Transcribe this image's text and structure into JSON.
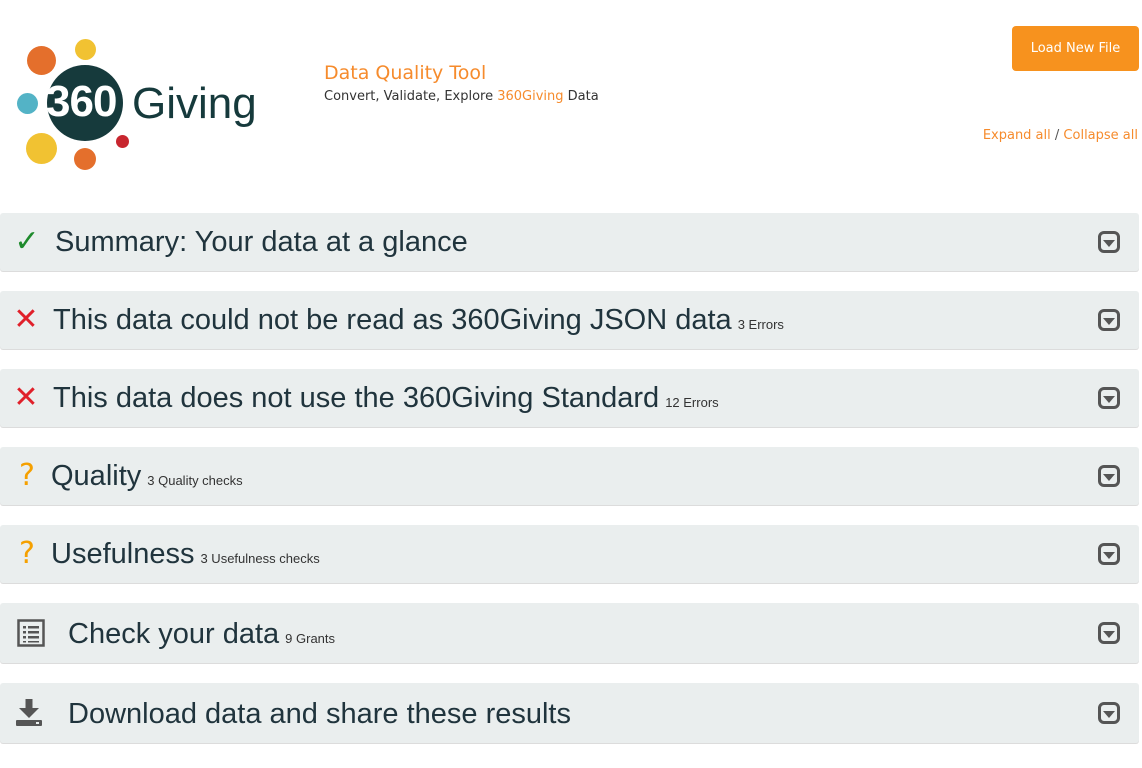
{
  "brand": {
    "logo_number": "360",
    "logo_word": "Giving",
    "colors": {
      "accent": "#f68b2c",
      "button": "#f7921e",
      "logo_dark": "#163a3c",
      "panel_bg": "#eaeeee",
      "ok": "#1e8a2c",
      "error": "#e0202a",
      "warning": "#f5a000"
    }
  },
  "header": {
    "tool_title": "Data Quality Tool",
    "subtitle_prefix": "Convert, Validate, Explore ",
    "subtitle_brand": "360Giving",
    "subtitle_suffix": " Data",
    "load_button": "Load New File",
    "expand_all": "Expand all",
    "separator": " / ",
    "collapse_all": "Collapse all"
  },
  "panels": [
    {
      "icon": "check-icon",
      "title": "Summary: Your data at a glance",
      "count": ""
    },
    {
      "icon": "cross-icon",
      "title": "This data could not be read as 360Giving JSON data",
      "count": "3 Errors"
    },
    {
      "icon": "cross-icon",
      "title": "This data does not use the 360Giving Standard",
      "count": "12 Errors"
    },
    {
      "icon": "question-icon",
      "title": "Quality",
      "count": "3 Quality checks"
    },
    {
      "icon": "question-icon",
      "title": "Usefulness",
      "count": "3 Usefulness checks"
    },
    {
      "icon": "list-icon",
      "title": "Check your data",
      "count": "9 Grants"
    },
    {
      "icon": "download-icon",
      "title": "Download data and share these results",
      "count": ""
    }
  ]
}
